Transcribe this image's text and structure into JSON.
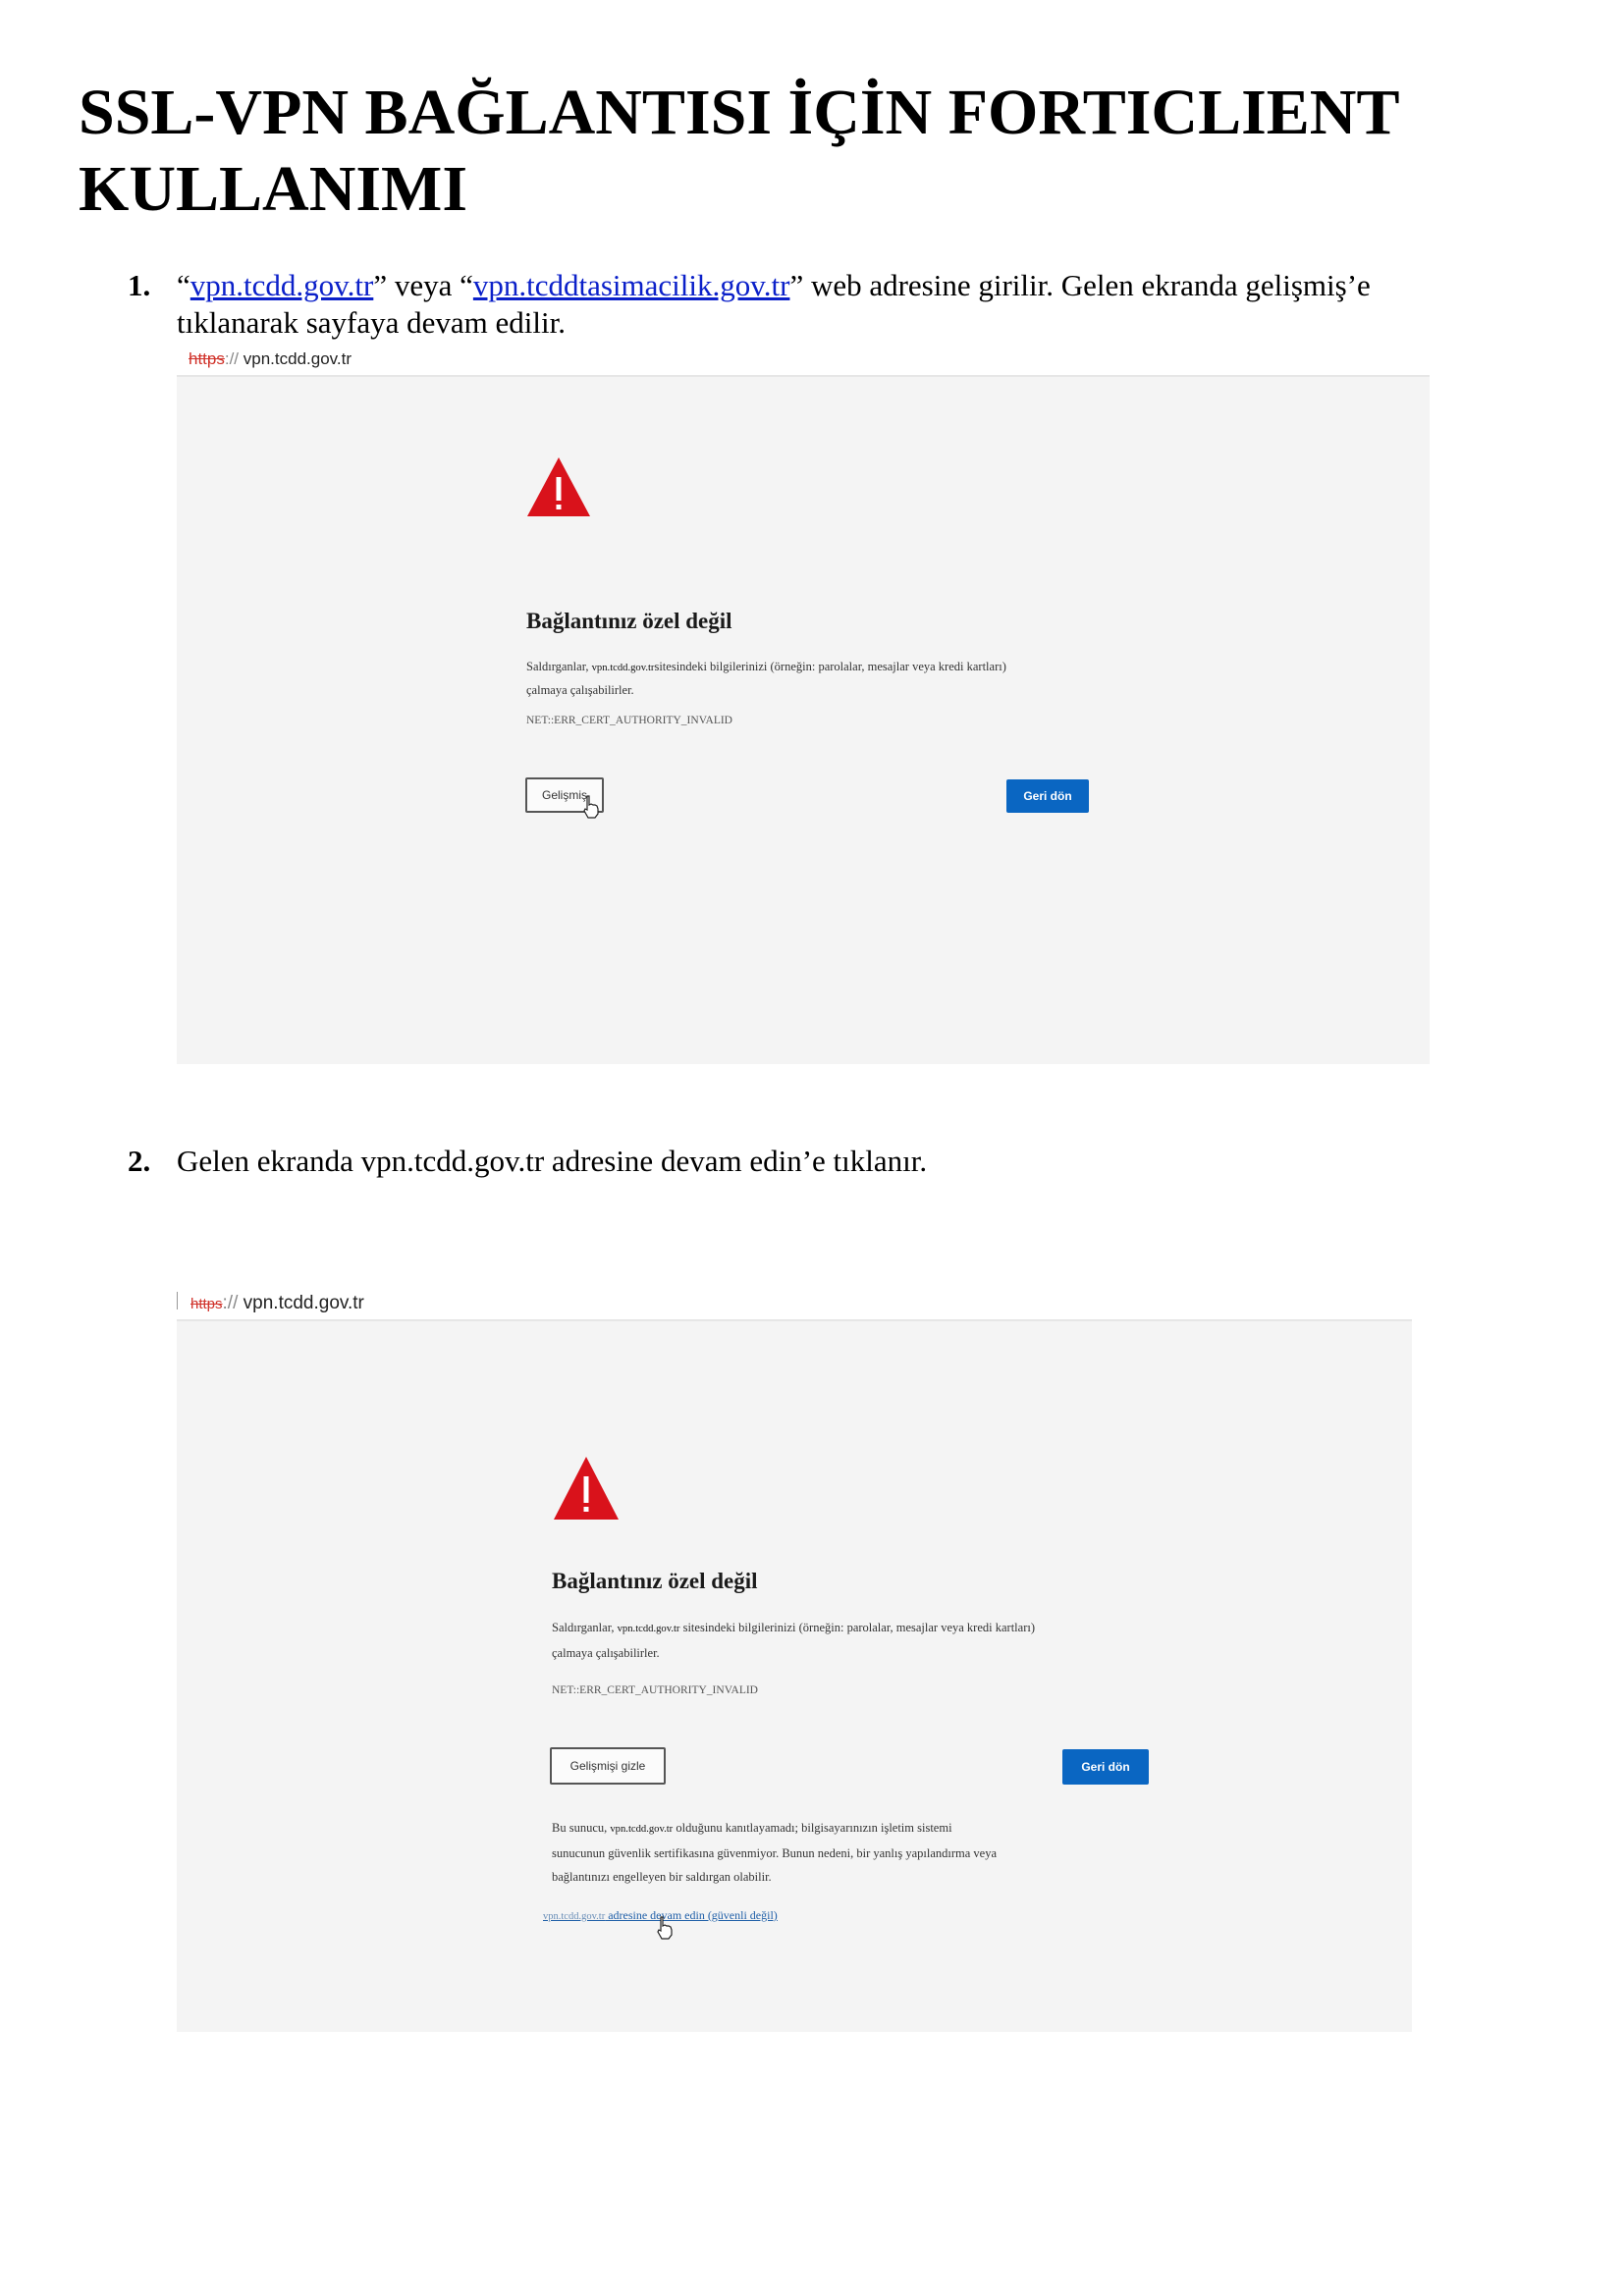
{
  "document": {
    "title": "SSL-VPN BAĞLANTISI İÇİN FORTICLIENT KULLANIMI"
  },
  "steps": [
    {
      "number": "1.",
      "text_quote_open_1": "“",
      "link_1": "vpn.tcdd.gov.tr",
      "text_mid": "” veya “",
      "link_2": "vpn.tcddtasimacilik.gov.tr",
      "text_after": "” web adresine girilir. Gelen ekranda gelişmiş’e",
      "text_line2": "tıklanarak sayfaya devam edilir."
    },
    {
      "number": "2.",
      "text": "Gelen ekranda vpn.tcdd.gov.tr adresine devam edin’e tıklanır."
    }
  ],
  "screenshot1": {
    "address_scheme": "https",
    "address_sep": "://",
    "address_host": "vpn.tcdd.gov.tr",
    "error_title": "Bağlantınız özel değil",
    "body_prefix": "Saldırganlar, ",
    "body_domain": "vpn.tcdd.gov.tr",
    "body_rest": "sitesindeki bilgilerinizi (örneğin: parolalar, mesajlar veya kredi kartları)",
    "body_line2": "çalmaya çalışabilirler.",
    "error_code": "NET::ERR_CERT_AUTHORITY_INVALID",
    "advanced_button": "Gelişmiş",
    "back_button": "Geri dön"
  },
  "screenshot2": {
    "address_scheme": "https",
    "address_sep": "://",
    "address_host": "vpn.tcdd.gov.tr",
    "error_title": "Bağlantınız özel değil",
    "body_prefix": "Saldırganlar, ",
    "body_domain": "vpn.tcdd.gov.tr",
    "body_rest": " sitesindeki bilgilerinizi (örneğin: parolalar, mesajlar veya kredi kartları)",
    "body_line2": "çalmaya çalışabilirler.",
    "error_code": "NET::ERR_CERT_AUTHORITY_INVALID",
    "hide_advanced_button": "Gelişmişi gizle",
    "back_button": "Geri dön",
    "adv_prefix": "Bu sunucu, ",
    "adv_domain": "vpn.tcdd.gov.tr",
    "adv_rest": " olduğunu kanıtlayamadı; bilgisayarınızın işletim sistemi",
    "adv_line2": "sunucunun güvenlik sertifikasına güvenmiyor. Bunun nedeni, bir yanlış yapılandırma veya",
    "adv_line3": "bağlantınızı engelleyen bir saldırgan olabilir.",
    "continue_domain": "vpn.tcdd.gov.tr",
    "continue_text": " adresine devam edin (güvenli değil)"
  },
  "colors": {
    "warning_red": "#d9121b",
    "button_blue": "#0a66c2",
    "panel_bg": "#f4f4f4",
    "link_blue": "#0b20c9"
  }
}
